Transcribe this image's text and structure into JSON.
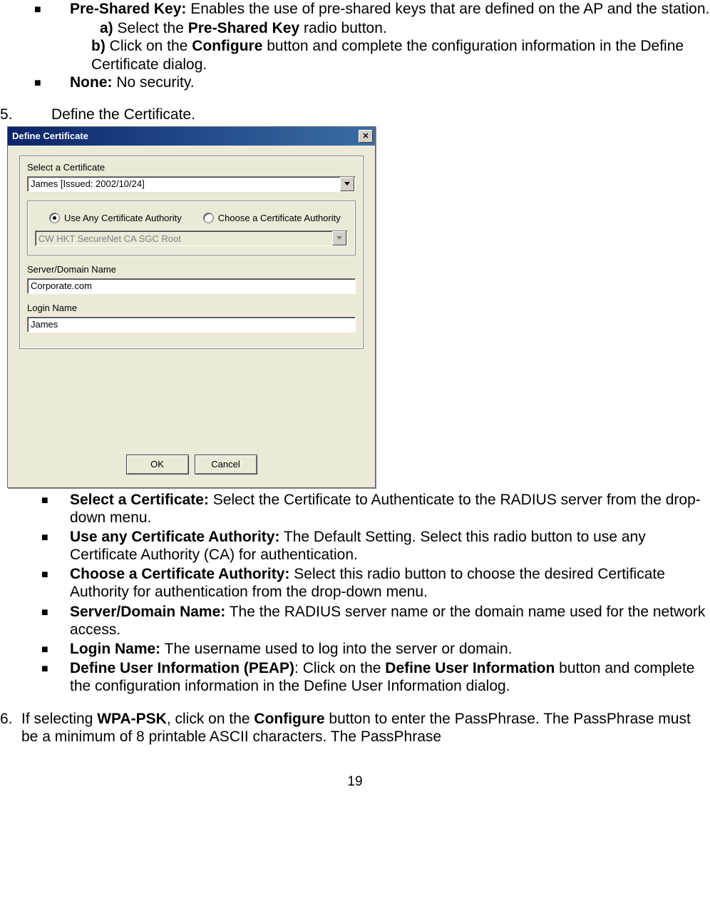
{
  "intro": {
    "psk_label": "Pre-Shared Key:",
    "psk_desc": " Enables the use of pre-shared keys that are defined on the AP and the station.",
    "psk_a_label": "a)",
    "psk_a_text": " Select the ",
    "psk_a_bold": "Pre-Shared Key",
    "psk_a_end": " radio button.",
    "psk_b_label": "b)",
    "psk_b_text": " Click on the ",
    "psk_b_bold": "Configure",
    "psk_b_end": " button and complete the configuration information in the Define Certificate dialog.",
    "none_label": "None:",
    "none_desc": " No security."
  },
  "step5": {
    "num": "5.",
    "text": "Define the Certificate."
  },
  "dialog": {
    "title": "Define Certificate",
    "cert_label": "Select a Certificate",
    "cert_value": "James   [Issued: 2002/10/24]",
    "radio_any": "Use Any Certificate Authority",
    "radio_choose": "Choose a Certificate Authority",
    "ca_value": "CW HKT SecureNet CA SGC Root",
    "server_label": "Server/Domain Name",
    "server_value": "Corporate.com",
    "login_label": "Login Name",
    "login_value": "James",
    "ok": "OK",
    "cancel": "Cancel"
  },
  "bullets": {
    "b1_label": "Select a Certificate:",
    "b1_text": " Select the Certificate to Authenticate to the RADIUS server from the drop-down menu.",
    "b2_label": "Use any Certificate Authority:",
    "b2_text": " The Default Setting. Select this radio button to use any Certificate Authority (CA) for authentication.",
    "b3_label": "Choose a Certificate Authority:",
    "b3_text": " Select this radio button to choose the desired Certificate Authority for authentication from the drop-down menu.",
    "b4_label": "Server/Domain Name:",
    "b4_text": " The the RADIUS server name or the domain name used for the network access.",
    "b5_label": "Login Name:",
    "b5_text": " The username used to log into the server or domain.",
    "b6_label": "Define User Information (PEAP)",
    "b6_text1": ": Click on the ",
    "b6_bold": "Define User Information",
    "b6_text2": " button and complete the configuration information in the Define User Information dialog."
  },
  "step6": {
    "num": "6.",
    "t1": "If selecting ",
    "bold1": "WPA-PSK",
    "t2": ", click on the ",
    "bold2": "Configure",
    "t3": " button to enter the PassPhrase. The PassPhrase must be a minimum of 8 printable ASCII characters. The PassPhrase"
  },
  "page_num": "19"
}
